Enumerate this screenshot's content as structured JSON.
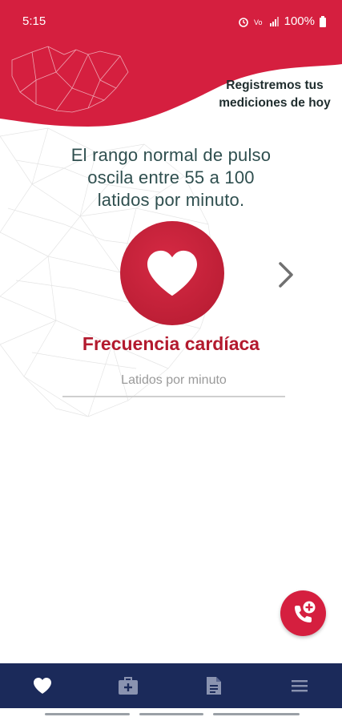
{
  "status_bar": {
    "time": "5:15",
    "battery": "100%"
  },
  "header": {
    "title_line1": "Registremos tus",
    "title_line2": "mediciones de hoy"
  },
  "info": {
    "line1": "El rango normal de pulso",
    "line2": "oscila entre 55 a 100",
    "line3": "latidos por minuto."
  },
  "metric": {
    "title": "Frecuencia cardíaca",
    "input_placeholder": "Latidos por minuto",
    "input_value": ""
  },
  "bottom_nav": {
    "items": [
      "heart-icon",
      "medical-kit-icon",
      "document-icon",
      "menu-icon"
    ]
  },
  "colors": {
    "accent_red": "#d51f3f",
    "dark_red": "#b31a2e",
    "nav_blue": "#1b2a5a",
    "text_teal": "#2f4f4f"
  }
}
